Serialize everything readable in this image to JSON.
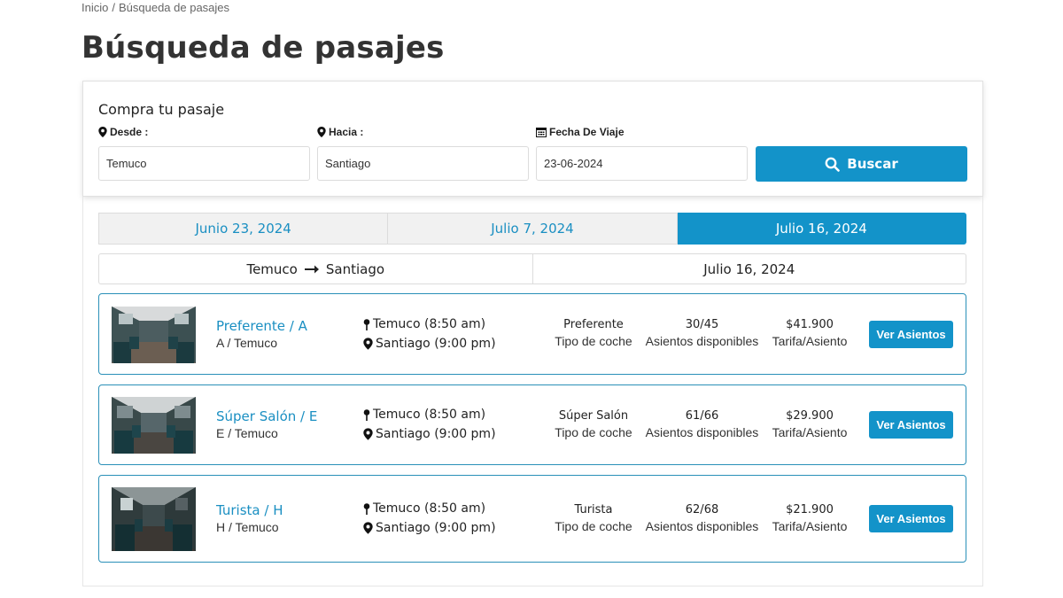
{
  "breadcrumb": {
    "home": "Inicio",
    "separator": "/",
    "current": "Búsqueda de pasajes"
  },
  "page_title": "Búsqueda de pasajes",
  "search": {
    "heading": "Compra tu pasaje",
    "from_label": "Desde :",
    "to_label": "Hacia :",
    "date_label": "Fecha De Viaje",
    "from_value": "Temuco",
    "to_value": "Santiago",
    "date_value": "23-06-2024",
    "button_label": "Buscar"
  },
  "date_tabs": [
    {
      "label": "Junio 23, 2024",
      "active": false
    },
    {
      "label": "Julio 7, 2024",
      "active": false
    },
    {
      "label": "Julio 16, 2024",
      "active": true
    }
  ],
  "route": {
    "origin": "Temuco",
    "destination": "Santiago",
    "date": "Julio 16, 2024"
  },
  "results": [
    {
      "name": "Preferente / A",
      "sub": "A / Temuco",
      "departure": "Temuco (8:50 am)",
      "arrival": "Santiago (9:00 pm)",
      "car_type": "Preferente",
      "car_type_label": "Tipo de coche",
      "seats": "30/45",
      "seats_label": "Asientos disponibles",
      "price": "$41.900",
      "price_label": "Tarifa/Asiento",
      "button": "Ver Asientos"
    },
    {
      "name": "Súper Salón / E",
      "sub": "E / Temuco",
      "departure": "Temuco (8:50 am)",
      "arrival": "Santiago (9:00 pm)",
      "car_type": "Súper Salón",
      "car_type_label": "Tipo de coche",
      "seats": "61/66",
      "seats_label": "Asientos disponibles",
      "price": "$29.900",
      "price_label": "Tarifa/Asiento",
      "button": "Ver Asientos"
    },
    {
      "name": "Turista / H",
      "sub": "H / Temuco",
      "departure": "Temuco (8:50 am)",
      "arrival": "Santiago (9:00 pm)",
      "car_type": "Turista",
      "car_type_label": "Tipo de coche",
      "seats": "62/68",
      "seats_label": "Asientos disponibles",
      "price": "$21.900",
      "price_label": "Tarifa/Asiento",
      "button": "Ver Asientos"
    }
  ],
  "colors": {
    "accent": "#1393c9",
    "link": "#1a8fc2",
    "card_border": "#2a90b8"
  },
  "icons": [
    "map-marker-icon",
    "calendar-icon",
    "search-icon",
    "arrow-right-icon",
    "pin-icon"
  ]
}
